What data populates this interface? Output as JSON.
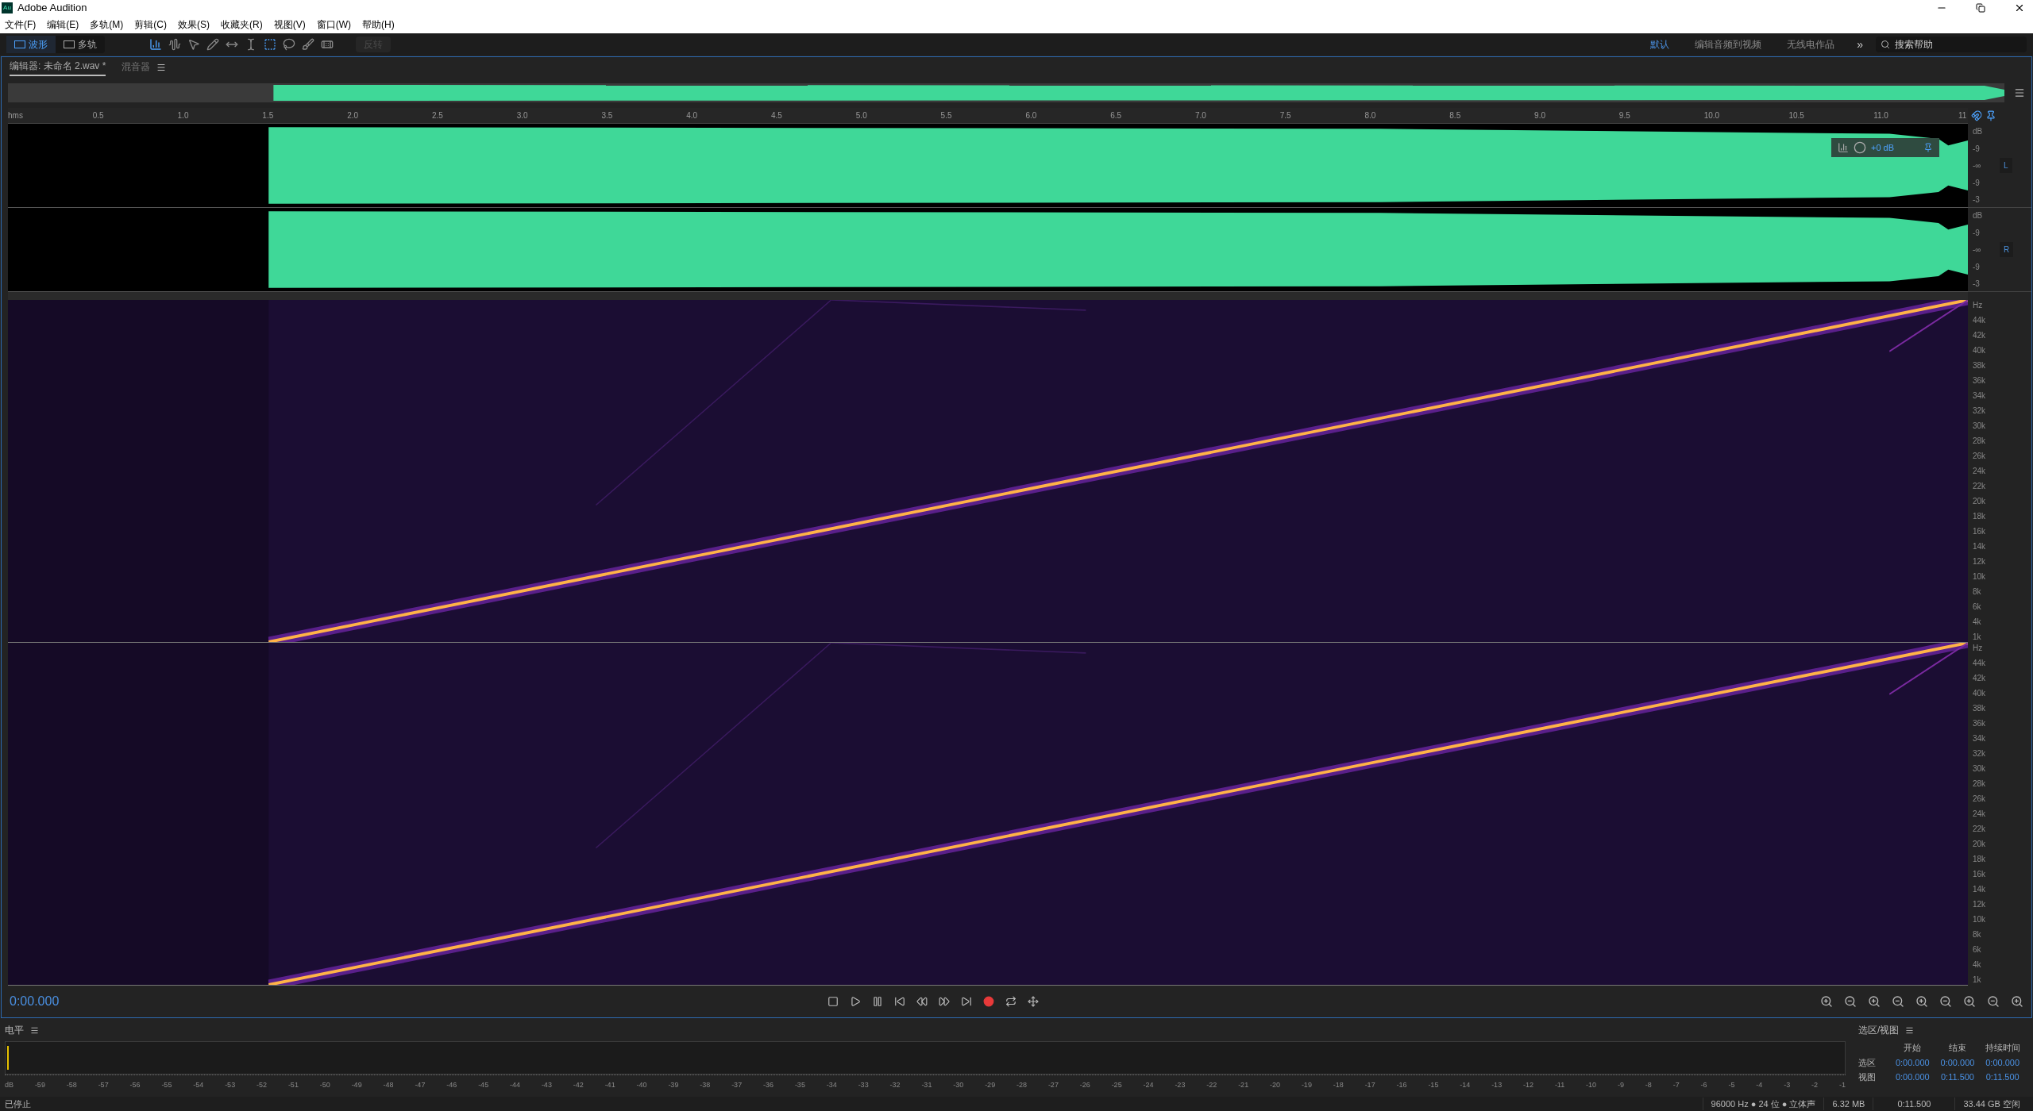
{
  "window": {
    "title": "Adobe Audition",
    "app_badge": "Au"
  },
  "menu": [
    "文件(F)",
    "编辑(E)",
    "多轨(M)",
    "剪辑(C)",
    "效果(S)",
    "收藏夹(R)",
    "视图(V)",
    "窗口(W)",
    "帮助(H)"
  ],
  "view_tabs": [
    {
      "label": "波形",
      "selected": true
    },
    {
      "label": "多轨",
      "selected": false
    }
  ],
  "toolbar": {
    "invert_button": {
      "label": "反转",
      "disabled": true
    }
  },
  "workspaces": [
    {
      "label": "默认",
      "selected": true
    },
    {
      "label": "编辑音频到视频",
      "selected": false
    },
    {
      "label": "无线电作品",
      "selected": false
    }
  ],
  "workspace_more": "»",
  "search": {
    "placeholder": "搜索帮助"
  },
  "panel_tabs": [
    {
      "label": "编辑器: 未命名 2.wav *",
      "selected": true
    },
    {
      "label": "混音器",
      "selected": false
    }
  ],
  "ruler": [
    "hms",
    "0.5",
    "1.0",
    "1.5",
    "2.0",
    "2.5",
    "3.0",
    "3.5",
    "4.0",
    "4.5",
    "5.0",
    "5.5",
    "6.0",
    "6.5",
    "7.0",
    "7.5",
    "8.0",
    "8.5",
    "9.0",
    "9.5",
    "10.0",
    "10.5",
    "11.0",
    "11"
  ],
  "hud": {
    "gain": "+0 dB"
  },
  "channels": [
    {
      "badge": "L",
      "db_scale": [
        "dB",
        "-9",
        "-∞",
        "-9",
        "-3"
      ]
    },
    {
      "badge": "R",
      "db_scale": [
        "dB",
        "-9",
        "-∞",
        "-9",
        "-3"
      ]
    }
  ],
  "spectrograms": [
    {
      "scale": [
        "Hz",
        "44k",
        "42k",
        "40k",
        "38k",
        "36k",
        "34k",
        "32k",
        "30k",
        "28k",
        "26k",
        "24k",
        "22k",
        "20k",
        "18k",
        "16k",
        "14k",
        "12k",
        "10k",
        "8k",
        "6k",
        "4k",
        "1k"
      ]
    },
    {
      "scale": [
        "Hz",
        "44k",
        "42k",
        "40k",
        "38k",
        "36k",
        "34k",
        "32k",
        "30k",
        "28k",
        "26k",
        "24k",
        "22k",
        "20k",
        "18k",
        "16k",
        "14k",
        "12k",
        "10k",
        "8k",
        "6k",
        "4k",
        "1k"
      ]
    }
  ],
  "transport": {
    "time": "0:00.000"
  },
  "levels": {
    "title": "电平",
    "ticks": [
      "dB",
      "-59",
      "-58",
      "-57",
      "-56",
      "-55",
      "-54",
      "-53",
      "-52",
      "-51",
      "-50",
      "-49",
      "-48",
      "-47",
      "-46",
      "-45",
      "-44",
      "-43",
      "-42",
      "-41",
      "-40",
      "-39",
      "-38",
      "-37",
      "-36",
      "-35",
      "-34",
      "-33",
      "-32",
      "-31",
      "-30",
      "-29",
      "-28",
      "-27",
      "-26",
      "-25",
      "-24",
      "-23",
      "-22",
      "-21",
      "-20",
      "-19",
      "-18",
      "-17",
      "-16",
      "-15",
      "-14",
      "-13",
      "-12",
      "-11",
      "-10",
      "-9",
      "-8",
      "-7",
      "-6",
      "-5",
      "-4",
      "-3",
      "-2",
      "-1"
    ]
  },
  "selection_view": {
    "title": "选区/视图",
    "columns": [
      "开始",
      "结束",
      "持续时间"
    ],
    "rows": [
      {
        "label": "选区",
        "values": [
          "0:00.000",
          "0:00.000",
          "0:00.000"
        ]
      },
      {
        "label": "视图",
        "values": [
          "0:00.000",
          "0:11.500",
          "0:11.500"
        ]
      }
    ]
  },
  "status_bar": {
    "state": "已停止",
    "format": "96000 Hz ● 24 位 ● 立体声",
    "size": "6.32 MB",
    "duration": "0:11.500",
    "free": "33.44 GB 空闲"
  }
}
